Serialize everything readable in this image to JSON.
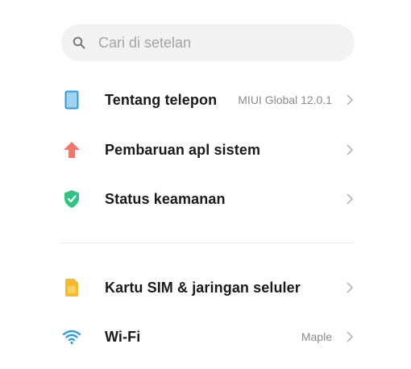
{
  "search": {
    "placeholder": "Cari di setelan",
    "icon": "search-icon"
  },
  "items": [
    {
      "label": "Tentang telepon",
      "value": "MIUI Global 12.0.1",
      "icon": "phone-icon",
      "icon_color": "#2f9bd8"
    },
    {
      "label": "Pembaruan apl sistem",
      "value": "",
      "icon": "arrow-up-icon",
      "icon_color": "#f0776a"
    },
    {
      "label": "Status keamanan",
      "value": "",
      "icon": "shield-icon",
      "icon_color": "#2fc484"
    },
    {
      "label": "Kartu SIM & jaringan seluler",
      "value": "",
      "icon": "sim-card-icon",
      "icon_color": "#f6b92b"
    },
    {
      "label": "Wi-Fi",
      "value": "Maple",
      "icon": "wifi-icon",
      "icon_color": "#2f9bd8"
    }
  ],
  "colors": {
    "search_bg": "#f2f2f2",
    "chevron": "#b5b5b5",
    "divider": "#ececec"
  }
}
